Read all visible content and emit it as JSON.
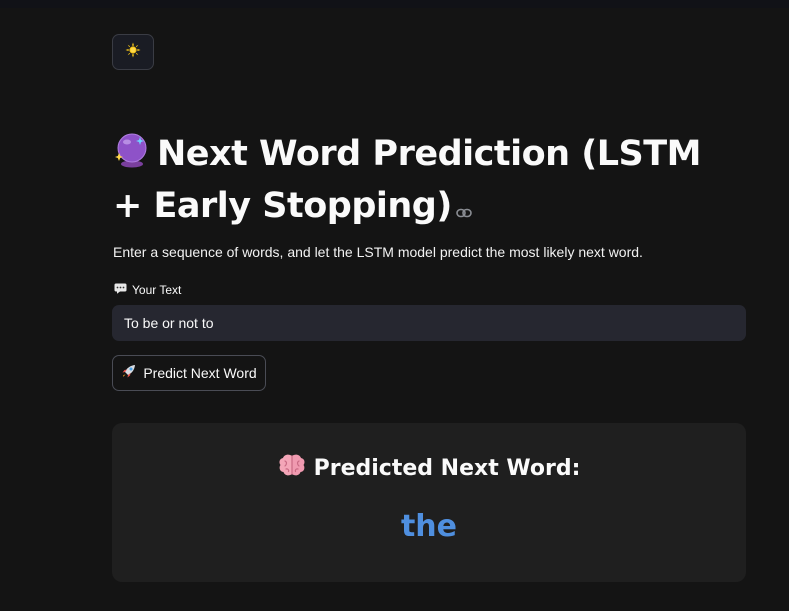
{
  "theme_toggle": {
    "icon": "sun-icon"
  },
  "header": {
    "title": "Next Word Prediction (LSTM + Early Stopping)",
    "title_icon": "crystal-ball-icon",
    "anchor_icon": "link-icon"
  },
  "description": "Enter a sequence of words, and let the LSTM model predict the most likely next word.",
  "input": {
    "label": "Your Text",
    "label_icon": "speech-bubble-icon",
    "value": "To be or not to"
  },
  "predict_button": {
    "label": "Predict Next Word",
    "icon": "rocket-icon"
  },
  "result": {
    "heading": "Predicted Next Word:",
    "heading_icon": "brain-icon",
    "word": "the",
    "word_color": "#4f8fdf"
  },
  "colors": {
    "background": "#141414",
    "input_background": "#262730",
    "card_background": "#1f1f1f",
    "accent": "#4f8fdf"
  }
}
